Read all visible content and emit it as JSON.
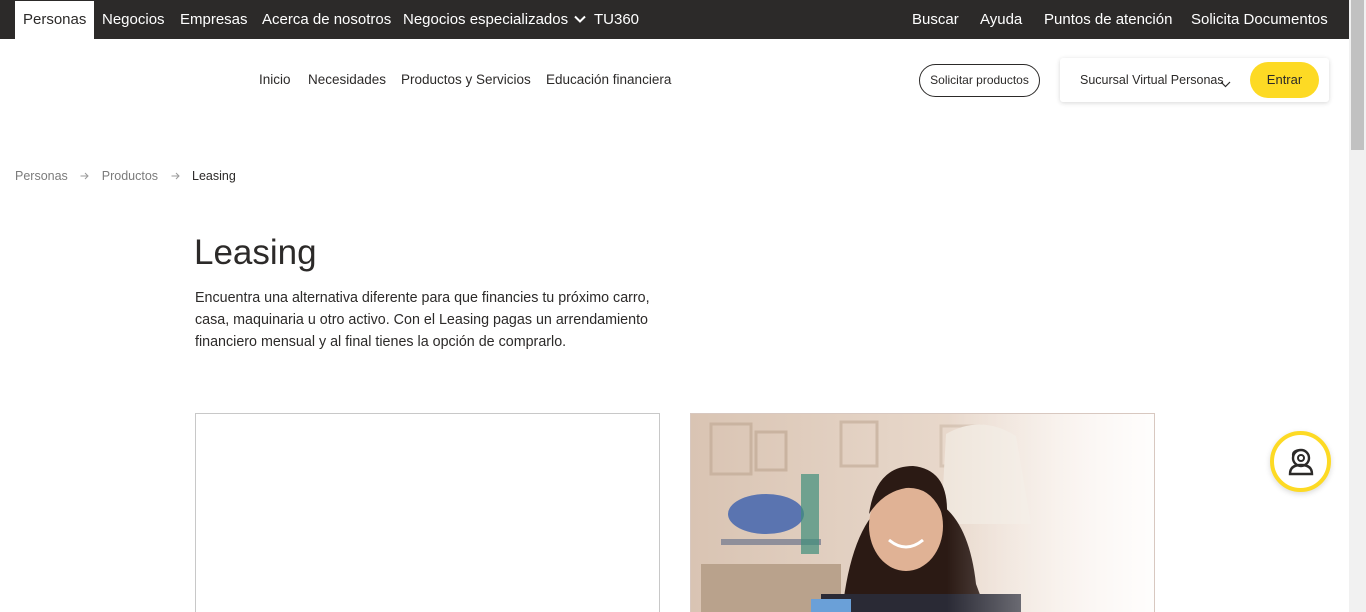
{
  "topbar": {
    "tabs": [
      {
        "label": "Personas",
        "active": true
      },
      {
        "label": "Negocios"
      },
      {
        "label": "Empresas"
      },
      {
        "label": "Acerca de nosotros"
      },
      {
        "label": "Negocios especializados"
      },
      {
        "label": "TU360"
      }
    ],
    "right": [
      "Buscar",
      "Ayuda",
      "Puntos de atención",
      "Solicita Documentos"
    ]
  },
  "mainnav": {
    "links": [
      "Inicio",
      "Necesidades",
      "Productos y Servicios",
      "Educación financiera"
    ],
    "solicitar_label": "Solicitar productos",
    "sucursal_label": "Sucursal Virtual Personas",
    "entrar_label": "Entrar"
  },
  "breadcrumb": [
    "Personas",
    "Productos",
    "Leasing"
  ],
  "hero": {
    "title": "Leasing",
    "description": "Encuentra una alternativa diferente para que financies tu próximo carro, casa, maquinaria u otro activo. Con el Leasing pagas un arrendamiento financiero mensual y al final tienes la opción de comprarlo."
  },
  "colors": {
    "topbar_bg": "#2c2a29",
    "accent_yellow": "#fdda24",
    "text": "#2c2a29"
  },
  "icons": {
    "chevron": "chevron-down-icon",
    "arrow": "arrow-right-icon",
    "chat": "chat-agent-icon"
  }
}
